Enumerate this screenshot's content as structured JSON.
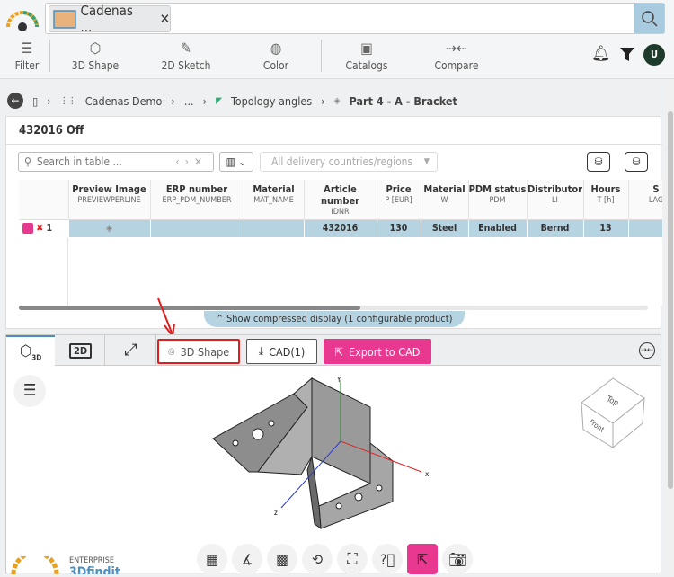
{
  "search": {
    "chip_label": "Cadenas ...",
    "close": "✕"
  },
  "toolbar": {
    "filter": "Filter",
    "shape3d": "3D Shape",
    "sketch2d": "2D Sketch",
    "color": "Color",
    "catalogs": "Catalogs",
    "compare": "Compare",
    "avatar": "U"
  },
  "breadcrumb": [
    "Cadenas Demo",
    "...",
    "Topology angles",
    "Part 4 - A - Bracket"
  ],
  "panel": {
    "title": "432016 Off",
    "search_placeholder": "Search in table ...",
    "region_placeholder": "All delivery countries/regions"
  },
  "table": {
    "columns": [
      {
        "label": "Preview Image",
        "sub": "PREVIEWPERLINE"
      },
      {
        "label": "ERP number",
        "sub": "ERP_PDM_NUMBER"
      },
      {
        "label": "Material",
        "sub": "MAT_NAME"
      },
      {
        "label": "Article number",
        "sub": "IDNR"
      },
      {
        "label": "Price",
        "sub": "P [EUR]"
      },
      {
        "label": "Material",
        "sub": "W"
      },
      {
        "label": "PDM status",
        "sub": "PDM"
      },
      {
        "label": "Distributor",
        "sub": "LI"
      },
      {
        "label": "Hours",
        "sub": "T [h]"
      },
      {
        "label": "S",
        "sub": "LAG"
      }
    ],
    "rows": [
      {
        "index": "1",
        "cells": [
          "",
          "",
          "",
          "432016",
          "130",
          "Steel",
          "Enabled",
          "Bernd",
          "13",
          ""
        ]
      }
    ]
  },
  "compressed_label": "Show compressed display (1 configurable product)",
  "viewer": {
    "tab_2d": "2D",
    "shape_btn": "3D Shape",
    "cad_btn": "CAD(1)",
    "export_btn": "Export to CAD",
    "axis_x": "x",
    "axis_y": "Y",
    "axis_z": "z",
    "cube_top": "Top",
    "cube_front": "Front",
    "brand_small": "ENTERPRISE",
    "brand": "3Dfindit"
  },
  "colors": {
    "accent": "#e8388f",
    "selected_row": "#b5d3e1",
    "search_btn": "#a9cbe0",
    "highlight": "#e01e1e"
  }
}
